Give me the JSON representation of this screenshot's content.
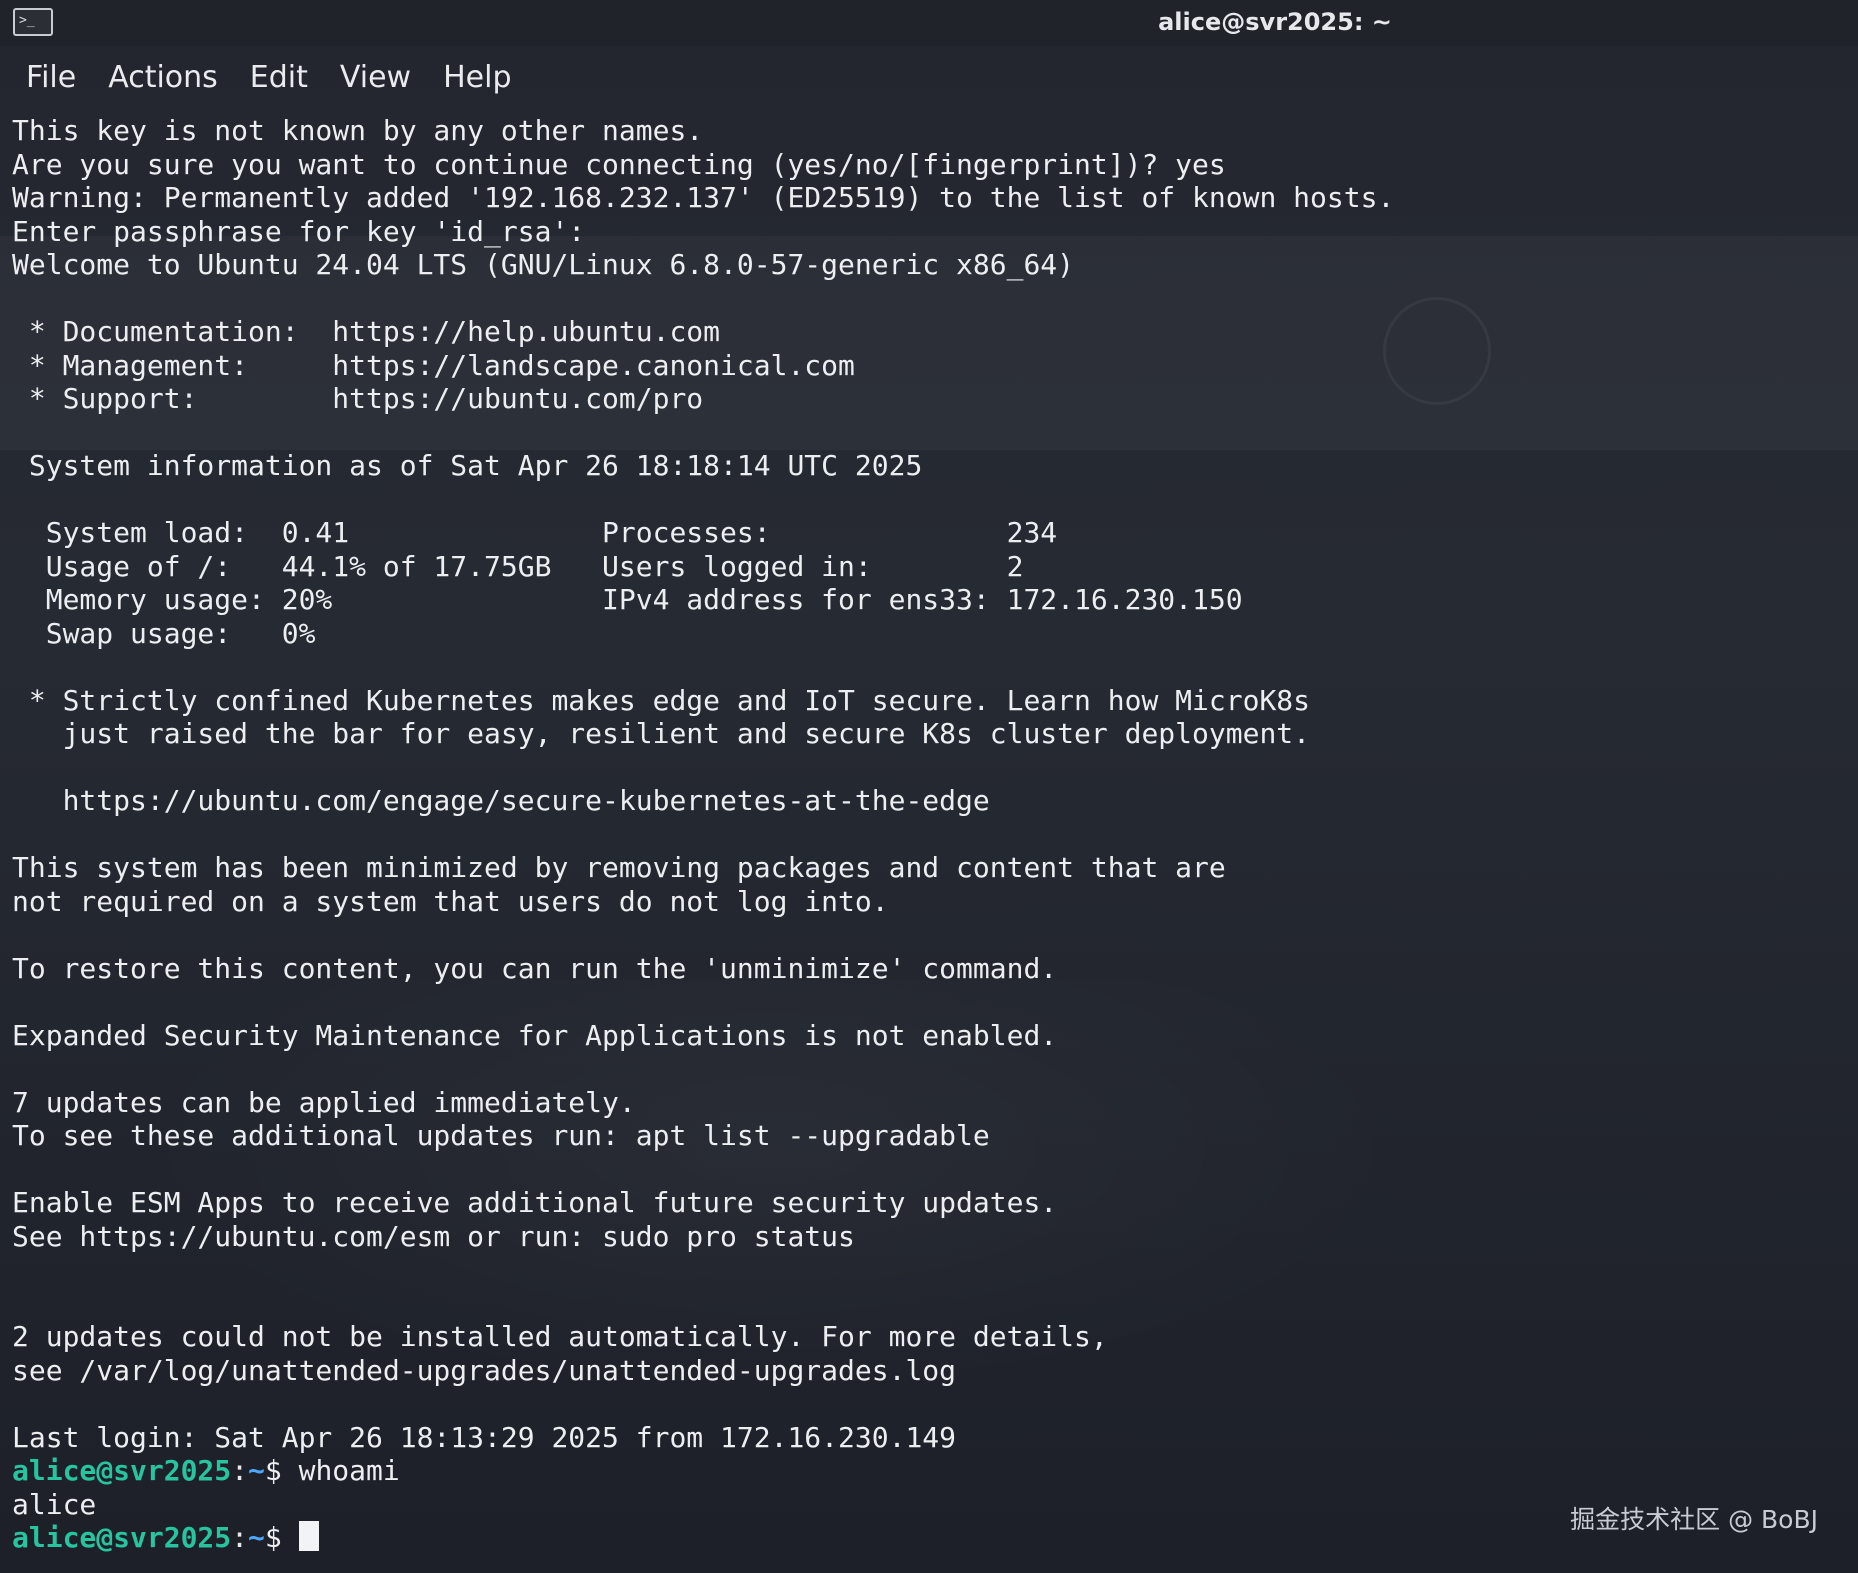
{
  "window": {
    "title": "alice@svr2025: ~",
    "icon": "terminal-icon"
  },
  "menu": {
    "items": [
      "File",
      "Actions",
      "Edit",
      "View",
      "Help"
    ]
  },
  "terminal": {
    "lines": [
      "This key is not known by any other names.",
      "Are you sure you want to continue connecting (yes/no/[fingerprint])? yes",
      "Warning: Permanently added '192.168.232.137' (ED25519) to the list of known hosts.",
      "Enter passphrase for key 'id_rsa':",
      "Welcome to Ubuntu 24.04 LTS (GNU/Linux 6.8.0-57-generic x86_64)",
      "",
      " * Documentation:  https://help.ubuntu.com",
      " * Management:     https://landscape.canonical.com",
      " * Support:        https://ubuntu.com/pro",
      "",
      " System information as of Sat Apr 26 18:18:14 UTC 2025",
      "",
      "  System load:  0.41               Processes:              234",
      "  Usage of /:   44.1% of 17.75GB   Users logged in:        2",
      "  Memory usage: 20%                IPv4 address for ens33: 172.16.230.150",
      "  Swap usage:   0%",
      "",
      " * Strictly confined Kubernetes makes edge and IoT secure. Learn how MicroK8s",
      "   just raised the bar for easy, resilient and secure K8s cluster deployment.",
      "",
      "   https://ubuntu.com/engage/secure-kubernetes-at-the-edge",
      "",
      "This system has been minimized by removing packages and content that are",
      "not required on a system that users do not log into.",
      "",
      "To restore this content, you can run the 'unminimize' command.",
      "",
      "Expanded Security Maintenance for Applications is not enabled.",
      "",
      "7 updates can be applied immediately.",
      "To see these additional updates run: apt list --upgradable",
      "",
      "Enable ESM Apps to receive additional future security updates.",
      "See https://ubuntu.com/esm or run: sudo pro status",
      "",
      "",
      "2 updates could not be installed automatically. For more details,",
      "see /var/log/unattended-upgrades/unattended-upgrades.log",
      "",
      "Last login: Sat Apr 26 18:13:29 2025 from 172.16.230.149"
    ],
    "prompt1": {
      "user_host": "alice@svr2025",
      "sep": ":",
      "path": "~",
      "symbol": "$ ",
      "command": "whoami"
    },
    "output": "alice",
    "prompt2": {
      "user_host": "alice@svr2025",
      "sep": ":",
      "path": "~",
      "symbol": "$ "
    }
  },
  "watermark": "掘金技术社区 @ BoBJ",
  "colors": {
    "prompt_user": "#27c4a0",
    "prompt_path": "#4ea7ff",
    "text": "#eceef1",
    "background": "#23262e"
  }
}
